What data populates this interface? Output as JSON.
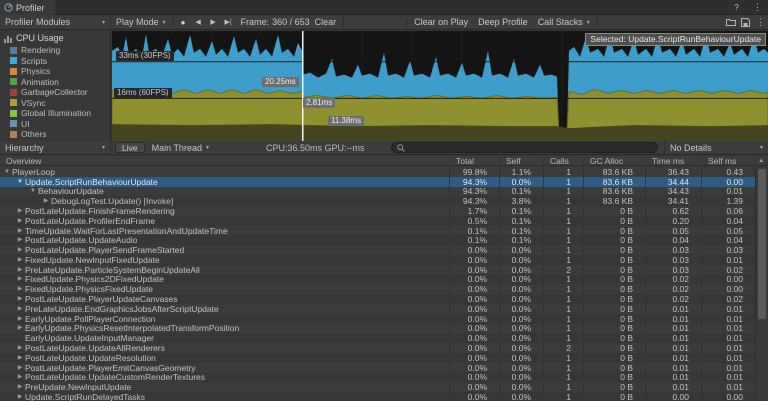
{
  "window": {
    "tab_title": "Profiler"
  },
  "icons": {
    "dropdown_arrow": "▾",
    "record": "●",
    "prev_frame": "◀",
    "next_frame": "▶",
    "current_frame": "▶|",
    "kebab_menu": "⋮",
    "help": "?",
    "sort_ascending": "▲",
    "expand_expanded": "▼",
    "expand_collapsed": "▶"
  },
  "toolbar": {
    "modules": "Profiler Modules",
    "play_mode": "Play Mode",
    "frame_label": "Frame:",
    "frame_value": "360 / 653",
    "clear": "Clear",
    "clear_on_play": "Clear on Play",
    "deep_profile": "Deep Profile",
    "call_stacks": "Call Stacks"
  },
  "sidebar": {
    "module_title": "CPU Usage",
    "legend": [
      {
        "label": "Rendering",
        "color": "#597C99"
      },
      {
        "label": "Scripts",
        "color": "#41A8DB"
      },
      {
        "label": "Physics",
        "color": "#D7863C"
      },
      {
        "label": "Animation",
        "color": "#4FA14F"
      },
      {
        "label": "GarbageCollector",
        "color": "#9E4040"
      },
      {
        "label": "VSync",
        "color": "#A3A33A"
      },
      {
        "label": "Global Illumination",
        "color": "#8CC63F"
      },
      {
        "label": "UI",
        "color": "#6A93B8"
      },
      {
        "label": "Others",
        "color": "#B0845A"
      }
    ]
  },
  "chart": {
    "label_33": "33ms (30FPS)",
    "label_16": "16ms (60FPS)",
    "marker_top": "20.25ms",
    "marker_mid": "2.81ms",
    "marker_low": "11.38ms",
    "selected_tooltip": "Selected: Update.ScriptRunBehaviourUpdate",
    "colors": {
      "scripts": "#3E9ECB",
      "vsync": "#8F9030",
      "others_band": "#45461F"
    }
  },
  "detail_toolbar": {
    "view": "Hierarchy",
    "live": "Live",
    "thread": "Main Thread",
    "cpu_gpu": "CPU:36.50ms GPU:--ms",
    "details": "No Details"
  },
  "search": {
    "value": ""
  },
  "table": {
    "columns": [
      "Overview",
      "Total",
      "Self",
      "Calls",
      "GC Alloc",
      "Time ms",
      "Self ms"
    ],
    "rows": [
      {
        "name": "PlayerLoop",
        "level": 0,
        "arrow": "expanded",
        "selected": false,
        "total": "99.8%",
        "self": "1.1%",
        "calls": "1",
        "gc_alloc": "83.6 KB",
        "time_ms": "36.43",
        "self_ms": "0.43"
      },
      {
        "name": "Update.ScriptRunBehaviourUpdate",
        "level": 1,
        "arrow": "expanded",
        "selected": true,
        "total": "94.3%",
        "self": "0.0%",
        "calls": "1",
        "gc_alloc": "83.6 KB",
        "time_ms": "34.44",
        "self_ms": "0.00"
      },
      {
        "name": "BehaviourUpdate",
        "level": 2,
        "arrow": "expanded",
        "selected": false,
        "total": "94.3%",
        "self": "0.1%",
        "calls": "1",
        "gc_alloc": "83.6 KB",
        "time_ms": "34.43",
        "self_ms": "0.01"
      },
      {
        "name": "DebugLogTest.Update() [Invoke]",
        "level": 3,
        "arrow": "collapsed",
        "selected": false,
        "total": "94.3%",
        "self": "3.8%",
        "calls": "1",
        "gc_alloc": "83.6 KB",
        "time_ms": "34.41",
        "self_ms": "1.39"
      },
      {
        "name": "PostLateUpdate.FinishFrameRendering",
        "level": 1,
        "arrow": "collapsed",
        "selected": false,
        "total": "1.7%",
        "self": "0.1%",
        "calls": "1",
        "gc_alloc": "0 B",
        "time_ms": "0.62",
        "self_ms": "0.06"
      },
      {
        "name": "PostLateUpdate.ProfilerEndFrame",
        "level": 1,
        "arrow": "collapsed",
        "selected": false,
        "total": "0.5%",
        "self": "0.1%",
        "calls": "1",
        "gc_alloc": "0 B",
        "time_ms": "0.20",
        "self_ms": "0.04"
      },
      {
        "name": "TimeUpdate.WaitForLastPresentationAndUpdateTime",
        "level": 1,
        "arrow": "collapsed",
        "selected": false,
        "total": "0.1%",
        "self": "0.1%",
        "calls": "1",
        "gc_alloc": "0 B",
        "time_ms": "0.05",
        "self_ms": "0.05"
      },
      {
        "name": "PostLateUpdate.UpdateAudio",
        "level": 1,
        "arrow": "collapsed",
        "selected": false,
        "total": "0.1%",
        "self": "0.1%",
        "calls": "1",
        "gc_alloc": "0 B",
        "time_ms": "0.04",
        "self_ms": "0.04"
      },
      {
        "name": "PostLateUpdate.PlayerSendFrameStarted",
        "level": 1,
        "arrow": "collapsed",
        "selected": false,
        "total": "0.0%",
        "self": "0.0%",
        "calls": "1",
        "gc_alloc": "0 B",
        "time_ms": "0.03",
        "self_ms": "0.03"
      },
      {
        "name": "FixedUpdate.NewInputFixedUpdate",
        "level": 1,
        "arrow": "collapsed",
        "selected": false,
        "total": "0.0%",
        "self": "0.0%",
        "calls": "1",
        "gc_alloc": "0 B",
        "time_ms": "0.03",
        "self_ms": "0.01"
      },
      {
        "name": "PreLateUpdate.ParticleSystemBeginUpdateAll",
        "level": 1,
        "arrow": "collapsed",
        "selected": false,
        "total": "0.0%",
        "self": "0.0%",
        "calls": "2",
        "gc_alloc": "0 B",
        "time_ms": "0.03",
        "self_ms": "0.02"
      },
      {
        "name": "FixedUpdate.Physics2DFixedUpdate",
        "level": 1,
        "arrow": "collapsed",
        "selected": false,
        "total": "0.0%",
        "self": "0.0%",
        "calls": "1",
        "gc_alloc": "0 B",
        "time_ms": "0.02",
        "self_ms": "0.00"
      },
      {
        "name": "FixedUpdate.PhysicsFixedUpdate",
        "level": 1,
        "arrow": "collapsed",
        "selected": false,
        "total": "0.0%",
        "self": "0.0%",
        "calls": "1",
        "gc_alloc": "0 B",
        "time_ms": "0.02",
        "self_ms": "0.00"
      },
      {
        "name": "PostLateUpdate.PlayerUpdateCanvases",
        "level": 1,
        "arrow": "collapsed",
        "selected": false,
        "total": "0.0%",
        "self": "0.0%",
        "calls": "1",
        "gc_alloc": "0 B",
        "time_ms": "0.02",
        "self_ms": "0.02"
      },
      {
        "name": "PreLateUpdate.EndGraphicsJobsAfterScriptUpdate",
        "level": 1,
        "arrow": "collapsed",
        "selected": false,
        "total": "0.0%",
        "self": "0.0%",
        "calls": "1",
        "gc_alloc": "0 B",
        "time_ms": "0.01",
        "self_ms": "0.01"
      },
      {
        "name": "EarlyUpdate.PollPlayerConnection",
        "level": 1,
        "arrow": "collapsed",
        "selected": false,
        "total": "0.0%",
        "self": "0.0%",
        "calls": "1",
        "gc_alloc": "0 B",
        "time_ms": "0.01",
        "self_ms": "0.01"
      },
      {
        "name": "EarlyUpdate.PhysicsResetInterpolatedTransformPosition",
        "level": 1,
        "arrow": "collapsed",
        "selected": false,
        "total": "0.0%",
        "self": "0.0%",
        "calls": "1",
        "gc_alloc": "0 B",
        "time_ms": "0.01",
        "self_ms": "0.01"
      },
      {
        "name": "EarlyUpdate.UpdateInputManager",
        "level": 1,
        "arrow": "none",
        "selected": false,
        "total": "0.0%",
        "self": "0.0%",
        "calls": "1",
        "gc_alloc": "0 B",
        "time_ms": "0.01",
        "self_ms": "0.01"
      },
      {
        "name": "PostLateUpdate.UpdateAllRenderers",
        "level": 1,
        "arrow": "collapsed",
        "selected": false,
        "total": "0.0%",
        "self": "0.0%",
        "calls": "2",
        "gc_alloc": "0 B",
        "time_ms": "0.01",
        "self_ms": "0.01"
      },
      {
        "name": "PostLateUpdate.UpdateResolution",
        "level": 1,
        "arrow": "collapsed",
        "selected": false,
        "total": "0.0%",
        "self": "0.0%",
        "calls": "1",
        "gc_alloc": "0 B",
        "time_ms": "0.01",
        "self_ms": "0.01"
      },
      {
        "name": "PostLateUpdate.PlayerEmitCanvasGeometry",
        "level": 1,
        "arrow": "collapsed",
        "selected": false,
        "total": "0.0%",
        "self": "0.0%",
        "calls": "1",
        "gc_alloc": "0 B",
        "time_ms": "0.01",
        "self_ms": "0.01"
      },
      {
        "name": "PostLateUpdate.UpdateCustomRenderTextures",
        "level": 1,
        "arrow": "collapsed",
        "selected": false,
        "total": "0.0%",
        "self": "0.0%",
        "calls": "1",
        "gc_alloc": "0 B",
        "time_ms": "0.01",
        "self_ms": "0.01"
      },
      {
        "name": "PreUpdate.NewInputUpdate",
        "level": 1,
        "arrow": "collapsed",
        "selected": false,
        "total": "0.0%",
        "self": "0.0%",
        "calls": "1",
        "gc_alloc": "0 B",
        "time_ms": "0.01",
        "self_ms": "0.01"
      },
      {
        "name": "Update.ScriptRunDelayedTasks",
        "level": 1,
        "arrow": "collapsed",
        "selected": false,
        "total": "0.0%",
        "self": "0.0%",
        "calls": "1",
        "gc_alloc": "0 B",
        "time_ms": "0.00",
        "self_ms": "0.00"
      }
    ]
  }
}
